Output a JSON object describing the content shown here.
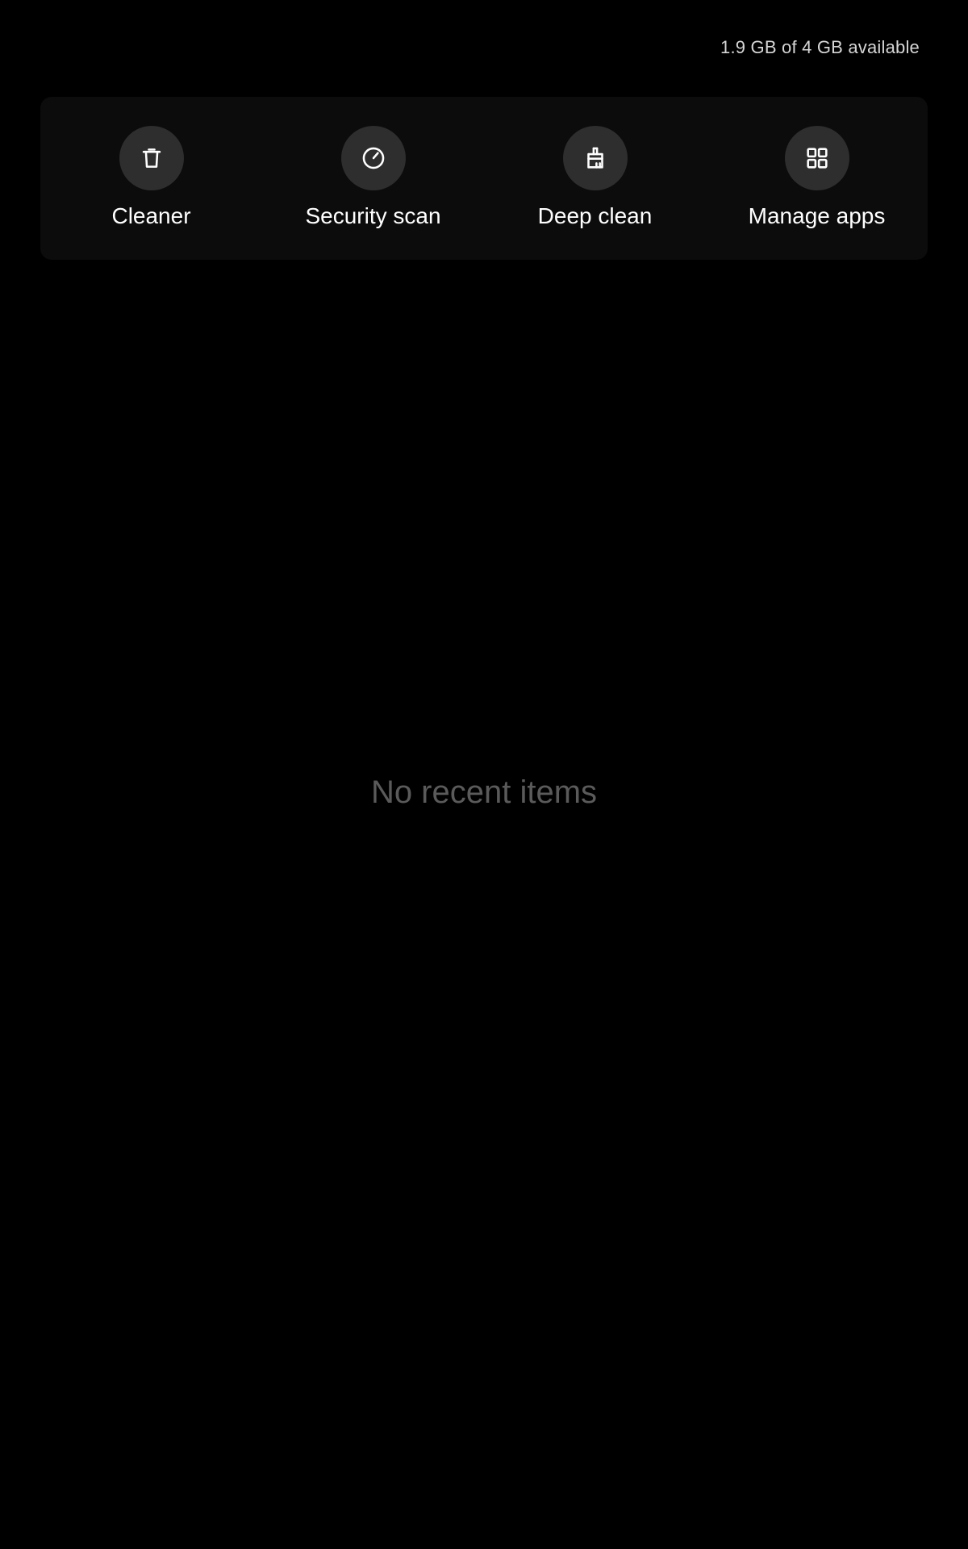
{
  "memory": {
    "status_text": "1.9 GB of 4 GB available"
  },
  "shortcuts": {
    "items": [
      {
        "label": "Cleaner",
        "icon": "trash-icon"
      },
      {
        "label": "Security scan",
        "icon": "gauge-icon"
      },
      {
        "label": "Deep clean",
        "icon": "broom-icon"
      },
      {
        "label": "Manage apps",
        "icon": "grid-icon"
      }
    ]
  },
  "recents": {
    "empty_text": "No recent items"
  },
  "colors": {
    "background": "#000000",
    "panel": "#0c0c0c",
    "icon_circle": "#2e2e2e",
    "text_primary": "#ffffff",
    "text_secondary": "#d6d6d6",
    "text_muted": "#5a5a5a"
  }
}
